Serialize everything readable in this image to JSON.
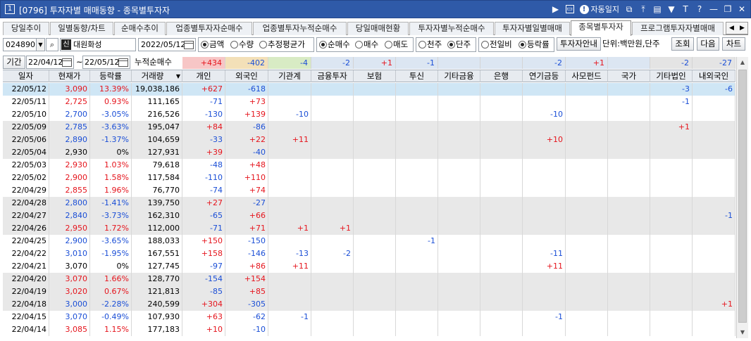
{
  "window": {
    "number": "1",
    "title": "[0796] 투자자별 매매동향 - 종목별투자자",
    "auto_label": "자동일지",
    "question": "?",
    "t_label": "T"
  },
  "tabs": [
    {
      "label": "당일추이",
      "active": false
    },
    {
      "label": "일별동향/차트",
      "active": false
    },
    {
      "label": "순매수추이",
      "active": false
    },
    {
      "label": "업종별투자자순매수",
      "active": false
    },
    {
      "label": "업종별투자누적순매수",
      "active": false
    },
    {
      "label": "당일매매현황",
      "active": false
    },
    {
      "label": "투자자별누적순매수",
      "active": false
    },
    {
      "label": "투자자별일별매매",
      "active": false
    },
    {
      "label": "종목별투자자",
      "active": true
    },
    {
      "label": "프로그램투자자별매매",
      "active": false
    }
  ],
  "controls": {
    "code": "024890",
    "credit_badge": "신",
    "stock_name": "대원화성",
    "date": "2022/05/12",
    "radio_amount": "금액",
    "radio_quantity": "수량",
    "radio_avg": "추정평균가",
    "radio_net": "순매수",
    "radio_buy": "매수",
    "radio_sell": "매도",
    "radio_thousand": "천주",
    "radio_unit": "단주",
    "radio_prev": "전일비",
    "radio_rate": "등락률",
    "investor_guide": "투자자안내",
    "unit_text": "단위:백만원,단주",
    "query_button": "조회",
    "next_button": "다음",
    "chart_button": "차트",
    "period_label": "기간",
    "from_date": "22/04/12",
    "tilde": "~",
    "to_date": "22/05/12",
    "cumulative_label": "누적순매수"
  },
  "summary": [
    "+434",
    "-402",
    "-4",
    "-2",
    "+1",
    "-1",
    "",
    "",
    "-2",
    "+1",
    "",
    "-2",
    "-27"
  ],
  "columns": [
    "일자",
    "현재가",
    "등락률",
    "거래량",
    "개인",
    "외국인",
    "기관계",
    "금융투자",
    "보험",
    "투신",
    "기타금융",
    "은행",
    "연기금등",
    "사모펀드",
    "국가",
    "기타법인",
    "내외국인"
  ],
  "rows": [
    {
      "date": "22/05/12",
      "price": "3,090",
      "rate": "13.39%",
      "dir": "up",
      "volume": "19,038,186",
      "vals": [
        "+627",
        "-618",
        "",
        "",
        "",
        "",
        "",
        "",
        "",
        "",
        "",
        "-3",
        "-6"
      ]
    },
    {
      "date": "22/05/11",
      "price": "2,725",
      "rate": "0.93%",
      "dir": "up",
      "volume": "111,165",
      "vals": [
        "-71",
        "+73",
        "",
        "",
        "",
        "",
        "",
        "",
        "",
        "",
        "",
        "-1",
        ""
      ]
    },
    {
      "date": "22/05/10",
      "price": "2,700",
      "rate": "-3.05%",
      "dir": "down",
      "volume": "216,526",
      "vals": [
        "-130",
        "+139",
        "-10",
        "",
        "",
        "",
        "",
        "",
        "-10",
        "",
        "",
        "",
        ""
      ]
    },
    {
      "date": "22/05/09",
      "price": "2,785",
      "rate": "-3.63%",
      "dir": "down",
      "volume": "195,047",
      "vals": [
        "+84",
        "-86",
        "",
        "",
        "",
        "",
        "",
        "",
        "",
        "",
        "",
        "+1",
        ""
      ]
    },
    {
      "date": "22/05/06",
      "price": "2,890",
      "rate": "-1.37%",
      "dir": "down",
      "volume": "104,659",
      "vals": [
        "-33",
        "+22",
        "+11",
        "",
        "",
        "",
        "",
        "",
        "+10",
        "",
        "",
        "",
        ""
      ]
    },
    {
      "date": "22/05/04",
      "price": "2,930",
      "rate": "0%",
      "dir": "flat",
      "volume": "127,931",
      "vals": [
        "+39",
        "-40",
        "",
        "",
        "",
        "",
        "",
        "",
        "",
        "",
        "",
        "",
        ""
      ]
    },
    {
      "date": "22/05/03",
      "price": "2,930",
      "rate": "1.03%",
      "dir": "up",
      "volume": "79,618",
      "vals": [
        "-48",
        "+48",
        "",
        "",
        "",
        "",
        "",
        "",
        "",
        "",
        "",
        "",
        ""
      ]
    },
    {
      "date": "22/05/02",
      "price": "2,900",
      "rate": "1.58%",
      "dir": "up",
      "volume": "117,584",
      "vals": [
        "-110",
        "+110",
        "",
        "",
        "",
        "",
        "",
        "",
        "",
        "",
        "",
        "",
        ""
      ]
    },
    {
      "date": "22/04/29",
      "price": "2,855",
      "rate": "1.96%",
      "dir": "up",
      "volume": "76,770",
      "vals": [
        "-74",
        "+74",
        "",
        "",
        "",
        "",
        "",
        "",
        "",
        "",
        "",
        "",
        ""
      ]
    },
    {
      "date": "22/04/28",
      "price": "2,800",
      "rate": "-1.41%",
      "dir": "down",
      "volume": "139,750",
      "vals": [
        "+27",
        "-27",
        "",
        "",
        "",
        "",
        "",
        "",
        "",
        "",
        "",
        "",
        ""
      ]
    },
    {
      "date": "22/04/27",
      "price": "2,840",
      "rate": "-3.73%",
      "dir": "down",
      "volume": "162,310",
      "vals": [
        "-65",
        "+66",
        "",
        "",
        "",
        "",
        "",
        "",
        "",
        "",
        "",
        "",
        "-1"
      ]
    },
    {
      "date": "22/04/26",
      "price": "2,950",
      "rate": "1.72%",
      "dir": "up",
      "volume": "112,000",
      "vals": [
        "-71",
        "+71",
        "+1",
        "+1",
        "",
        "",
        "",
        "",
        "",
        "",
        "",
        "",
        ""
      ]
    },
    {
      "date": "22/04/25",
      "price": "2,900",
      "rate": "-3.65%",
      "dir": "down",
      "volume": "188,033",
      "vals": [
        "+150",
        "-150",
        "",
        "",
        "",
        "-1",
        "",
        "",
        "",
        "",
        "",
        "",
        ""
      ]
    },
    {
      "date": "22/04/22",
      "price": "3,010",
      "rate": "-1.95%",
      "dir": "down",
      "volume": "167,551",
      "vals": [
        "+158",
        "-146",
        "-13",
        "-2",
        "",
        "",
        "",
        "",
        "-11",
        "",
        "",
        "",
        ""
      ]
    },
    {
      "date": "22/04/21",
      "price": "3,070",
      "rate": "0%",
      "dir": "flat",
      "volume": "127,745",
      "vals": [
        "-97",
        "+86",
        "+11",
        "",
        "",
        "",
        "",
        "",
        "+11",
        "",
        "",
        "",
        ""
      ]
    },
    {
      "date": "22/04/20",
      "price": "3,070",
      "rate": "1.66%",
      "dir": "up",
      "volume": "128,770",
      "vals": [
        "-154",
        "+154",
        "",
        "",
        "",
        "",
        "",
        "",
        "",
        "",
        "",
        "",
        ""
      ]
    },
    {
      "date": "22/04/19",
      "price": "3,020",
      "rate": "0.67%",
      "dir": "up",
      "volume": "121,813",
      "vals": [
        "-85",
        "+85",
        "",
        "",
        "",
        "",
        "",
        "",
        "",
        "",
        "",
        "",
        ""
      ]
    },
    {
      "date": "22/04/18",
      "price": "3,000",
      "rate": "-2.28%",
      "dir": "down",
      "volume": "240,599",
      "vals": [
        "+304",
        "-305",
        "",
        "",
        "",
        "",
        "",
        "",
        "",
        "",
        "",
        "",
        "+1"
      ]
    },
    {
      "date": "22/04/15",
      "price": "3,070",
      "rate": "-0.49%",
      "dir": "down",
      "volume": "107,930",
      "vals": [
        "+63",
        "-62",
        "-1",
        "",
        "",
        "",
        "",
        "",
        "-1",
        "",
        "",
        "",
        ""
      ]
    },
    {
      "date": "22/04/14",
      "price": "3,085",
      "rate": "1.15%",
      "dir": "up",
      "volume": "177,183",
      "vals": [
        "+10",
        "-10",
        "",
        "",
        "",
        "",
        "",
        "",
        "",
        "",
        "",
        "",
        ""
      ]
    }
  ],
  "colors": {
    "titlebar": "#2f5aa8",
    "up": "#e5141c",
    "down": "#1a4ed6",
    "selected_row": "#cfe6f5",
    "shaded_row": "#e8e8e8",
    "summary_individual": "#f7c6c6",
    "summary_foreign": "#f3e0b8",
    "summary_institution": "#d8ebc4",
    "summary_other": "#dce6f2"
  },
  "icons": [
    "arrow-right-icon",
    "screen-icon",
    "info-icon",
    "popout-icon",
    "upload-icon",
    "layout-icon",
    "pin-icon",
    "minimize-icon",
    "restore-icon",
    "close-icon",
    "search-icon",
    "calendar-icon",
    "dropdown-icon",
    "sort-icon"
  ]
}
